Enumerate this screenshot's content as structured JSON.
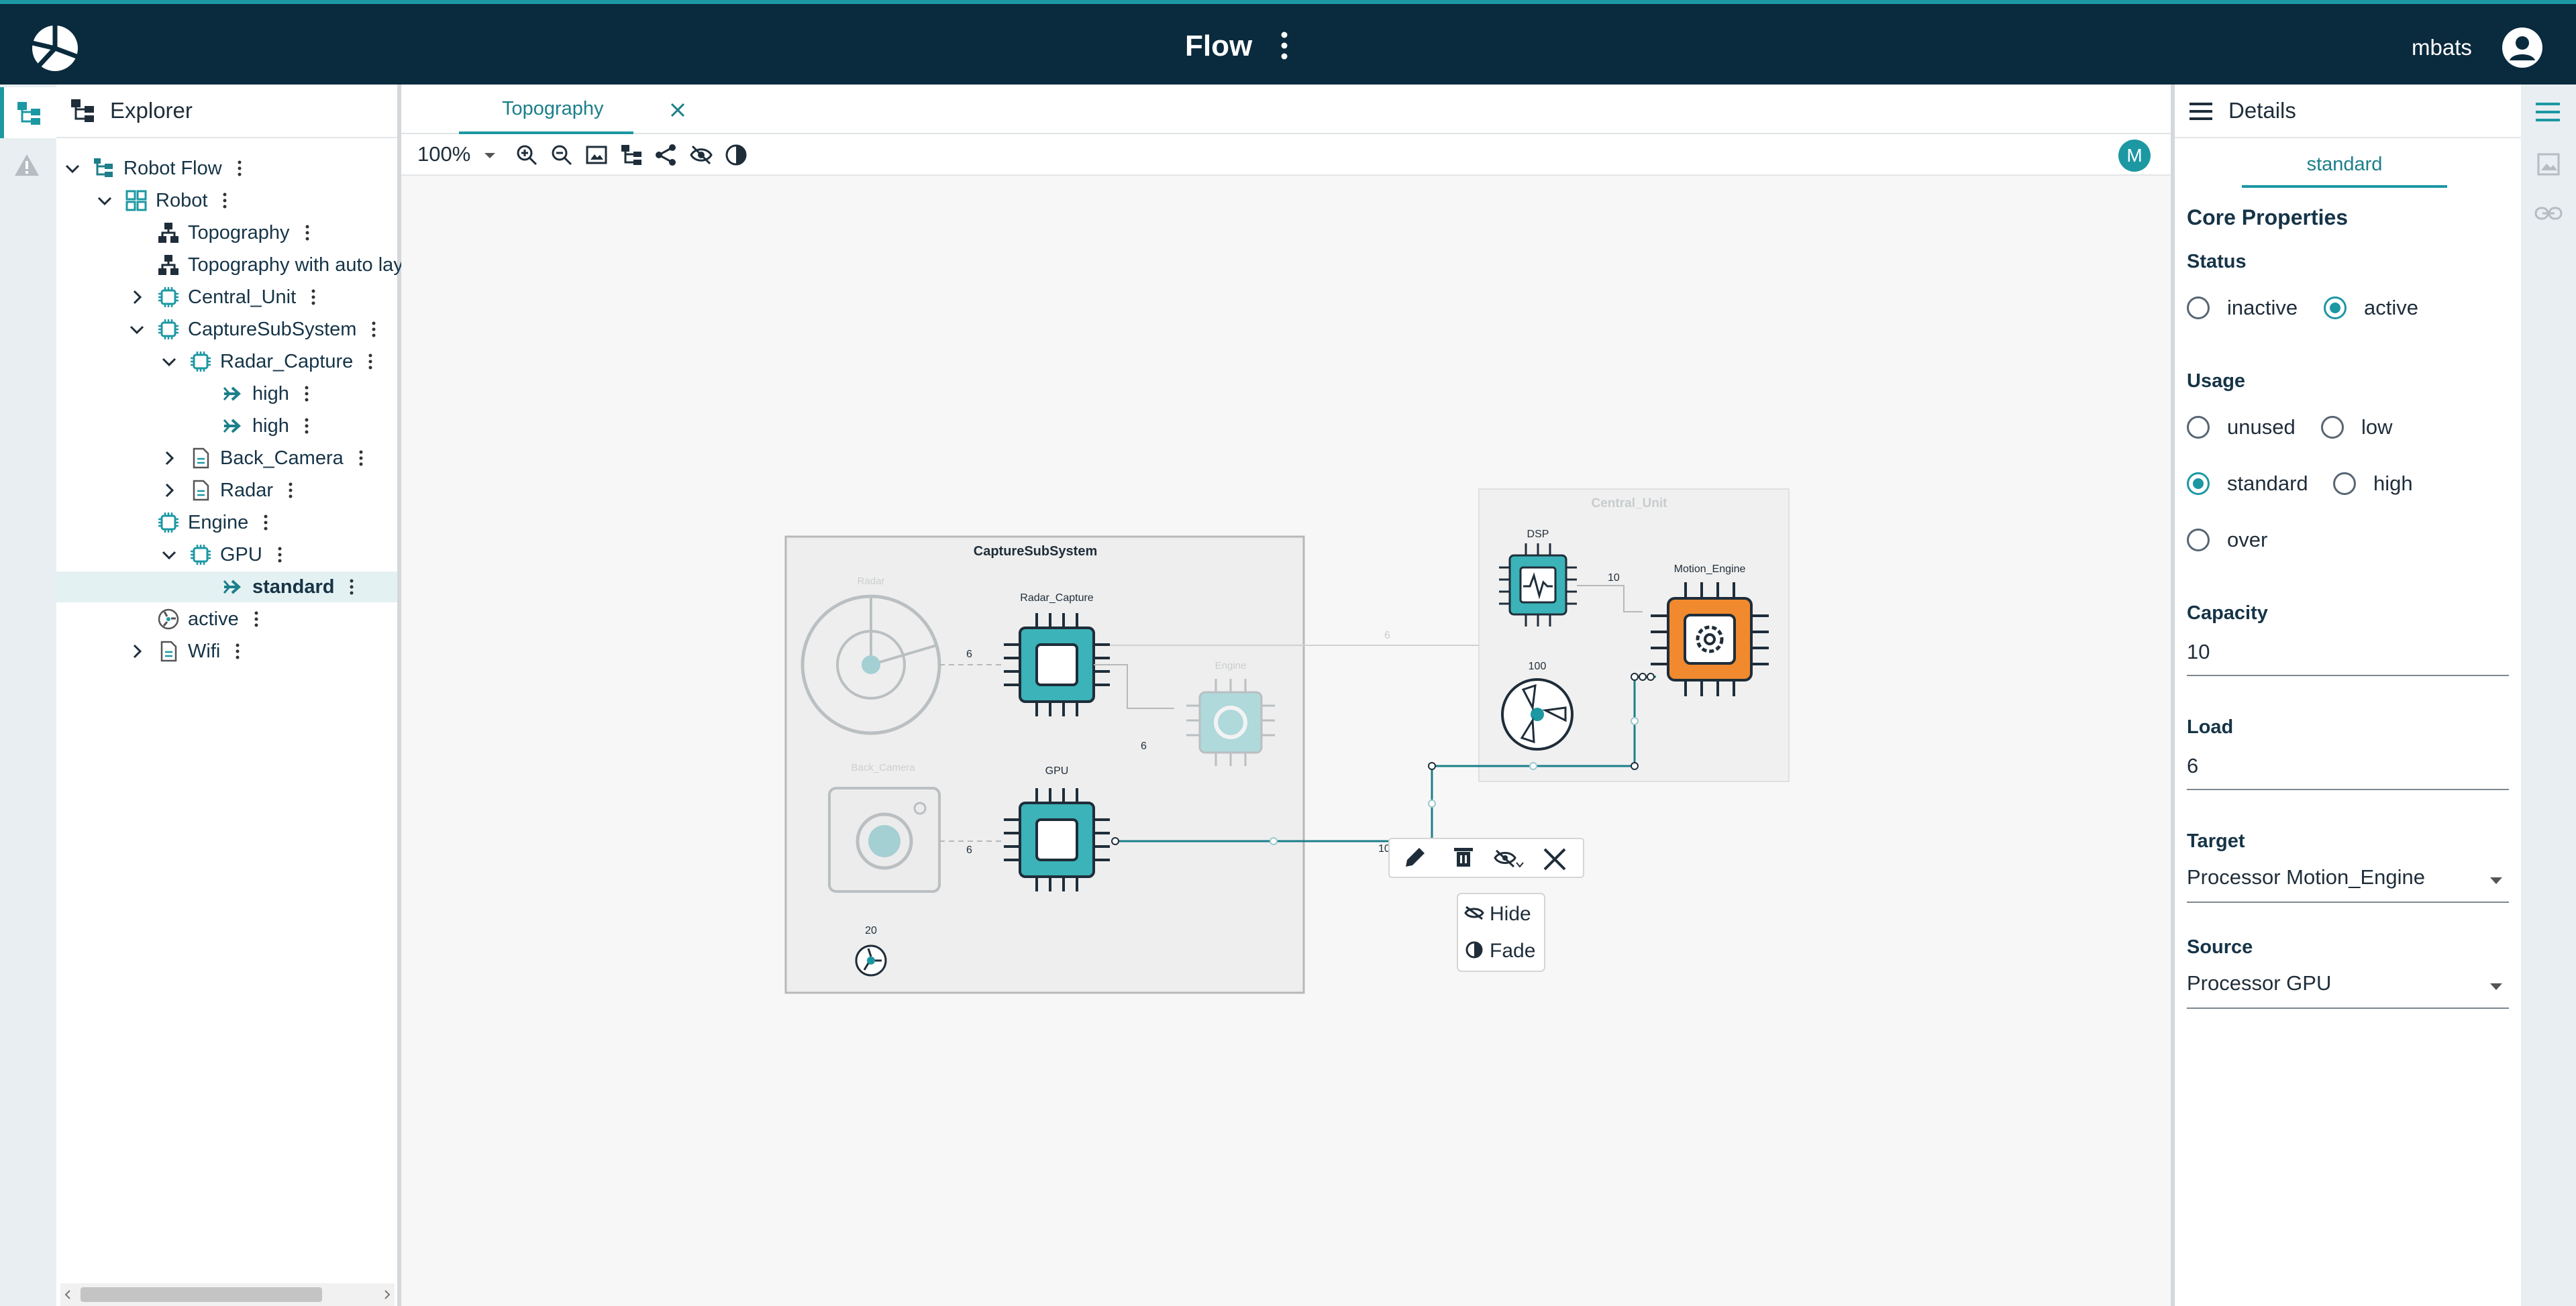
{
  "app": {
    "title": "Flow",
    "user": "mbats"
  },
  "explorer": {
    "title": "Explorer",
    "tree": [
      {
        "label": "Robot Flow",
        "icon": "tree-icon"
      },
      {
        "label": "Robot",
        "icon": "grid-icon"
      },
      {
        "label": "Topography",
        "icon": "topology-icon"
      },
      {
        "label": "Topography with auto layout",
        "icon": "topology-icon"
      },
      {
        "label": "Central_Unit",
        "icon": "processor-icon"
      },
      {
        "label": "CaptureSubSystem",
        "icon": "processor-icon"
      },
      {
        "label": "Radar_Capture",
        "icon": "processor-icon"
      },
      {
        "label": "high",
        "icon": "arrow-icon"
      },
      {
        "label": "high",
        "icon": "arrow-icon"
      },
      {
        "label": "Back_Camera",
        "icon": "file-icon"
      },
      {
        "label": "Radar",
        "icon": "file-icon"
      },
      {
        "label": "Engine",
        "icon": "processor-icon"
      },
      {
        "label": "GPU",
        "icon": "processor-icon"
      },
      {
        "label": "standard",
        "icon": "arrow-icon"
      },
      {
        "label": "active",
        "icon": "fan-icon"
      },
      {
        "label": "Wifi",
        "icon": "file-icon"
      }
    ]
  },
  "editor": {
    "tab_label": "Topography",
    "zoom": "100%",
    "mode_badge": "M"
  },
  "diagram": {
    "capture_title": "CaptureSubSystem",
    "central_title": "Central_Unit",
    "radar": "Radar",
    "radar_capture": "Radar_Capture",
    "engine": "Engine",
    "back_camera": "Back_Camera",
    "gpu": "GPU",
    "dsp": "DSP",
    "motion_engine": "Motion_Engine",
    "fan_top": "100",
    "fan_bottom": "20",
    "edge_radar": "6",
    "edge_rc_engine": "6",
    "edge_camera": "6",
    "edge_top": "6",
    "edge_dsp": "10",
    "edge_gpu": "10",
    "menu": {
      "hide": "Hide",
      "fade": "Fade"
    }
  },
  "details": {
    "title": "Details",
    "tab": "standard",
    "section": "Core Properties",
    "status": {
      "label": "Status",
      "options": [
        "inactive",
        "active"
      ],
      "selected": "active"
    },
    "usage": {
      "label": "Usage",
      "options": [
        "unused",
        "low",
        "standard",
        "high",
        "over"
      ],
      "selected": "standard"
    },
    "capacity": {
      "label": "Capacity",
      "value": "10"
    },
    "load": {
      "label": "Load",
      "value": "6"
    },
    "target": {
      "label": "Target",
      "value": "Processor Motion_Engine"
    },
    "source": {
      "label": "Source",
      "value": "Processor GPU"
    }
  },
  "colors": {
    "header": "#0a2a3d",
    "accent": "#1c98a3",
    "chip": "#3bb3b8",
    "motion_engine": "#f18a2e"
  }
}
